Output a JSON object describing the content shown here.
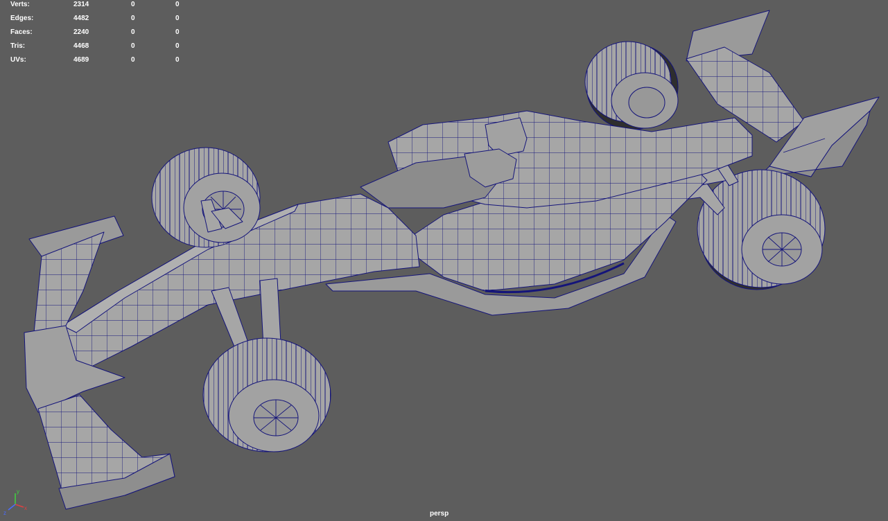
{
  "poly_count": {
    "rows": [
      {
        "label": "Verts:",
        "values": [
          "2314",
          "0",
          "0"
        ]
      },
      {
        "label": "Edges:",
        "values": [
          "4482",
          "0",
          "0"
        ]
      },
      {
        "label": "Faces:",
        "values": [
          "2240",
          "0",
          "0"
        ]
      },
      {
        "label": "Tris:",
        "values": [
          "4468",
          "0",
          "0"
        ]
      },
      {
        "label": "UVs:",
        "values": [
          "4689",
          "0",
          "0"
        ]
      }
    ]
  },
  "viewport": {
    "camera_label": "persp",
    "background_color": "#5d5d5d",
    "wireframe_color": "#14147a",
    "shaded_color": "#a6a6a6"
  },
  "axis_gizmo": {
    "x_label": "x",
    "y_label": "y",
    "z_label": "z"
  }
}
